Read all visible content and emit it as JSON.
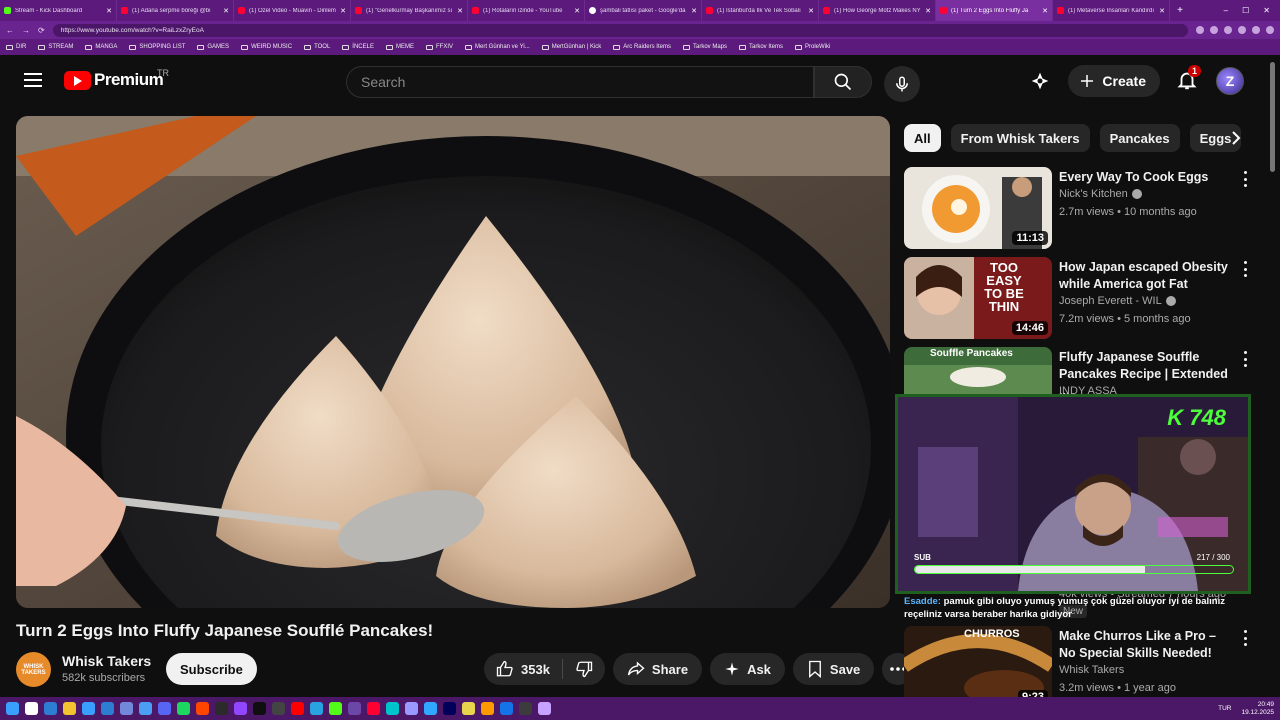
{
  "browser": {
    "tabs": [
      {
        "title": "Stream - Kick Dashboard",
        "fav": "kick"
      },
      {
        "title": "(1) Adana serpme böreği @bi",
        "fav": "yt"
      },
      {
        "title": "(1) Özel Video - Muavin - Dinlem",
        "fav": "yt"
      },
      {
        "title": "(1) \"Genelkurmay Başkanımız sı",
        "fav": "yt"
      },
      {
        "title": "(1) Rotaların izinde - YouTube",
        "fav": "yt"
      },
      {
        "title": "şambali tatlısı paket - Google'da",
        "fav": "g"
      },
      {
        "title": "(1) İstanbul'da İlk Ve Tek Sobalı",
        "fav": "yt"
      },
      {
        "title": "(1) How George Motz Makes NY",
        "fav": "yt"
      },
      {
        "title": "(1) Turn 2 Eggs Into Fluffy Ja",
        "fav": "yt",
        "active": true
      },
      {
        "title": "(1) Metaverse İnsanları Kandırdı",
        "fav": "yt"
      }
    ],
    "new_tab": "+",
    "window_controls": [
      "–",
      "☐",
      "✕"
    ],
    "url": "https://www.youtube.com/watch?v=RaiLzxZryEoA",
    "bookmarks": [
      "DIR",
      "STREAM",
      "MANGA",
      "SHOPPING LIST",
      "GAMES",
      "WEIRD MUSIC",
      "TOOL",
      "İNCELE",
      "MEME",
      "FFXIV",
      "Mert Günhan ve Yi...",
      "MertGünhan | Kick",
      "Arc Raiders Items",
      "Tarkov Maps",
      "Tarkov Items",
      "ProleWiki"
    ]
  },
  "header": {
    "logo_text": "Premium",
    "region": "TR",
    "search_placeholder": "Search",
    "create_label": "Create",
    "notification_count": "1",
    "avatar_letter": "Z"
  },
  "video": {
    "title": "Turn 2 Eggs Into Fluffy Japanese Soufflé Pancakes!",
    "channel": "Whisk Takers",
    "channel_avatar_text": "WHISK TAKERS",
    "subscribers": "582k subscribers",
    "subscribe_label": "Subscribe",
    "likes": "353k",
    "share_label": "Share",
    "ask_label": "Ask",
    "save_label": "Save"
  },
  "chips": [
    "All",
    "From Whisk Takers",
    "Pancakes",
    "Eggs"
  ],
  "recommendations": [
    {
      "title": "Every Way To Cook Eggs",
      "channel": "Nick's Kitchen",
      "verified": true,
      "meta": "2.7m views • 10 months ago",
      "duration": "11:13"
    },
    {
      "title": "How Japan escaped Obesity while America got Fat",
      "channel": "Joseph Everett - WIL",
      "verified": true,
      "meta": "7.2m views • 5 months ago",
      "duration": "14:46",
      "thumb_text": "TOO EASY TO BE THIN"
    },
    {
      "title": "Fluffy Japanese Souffle Pancakes Recipe | Extended ...",
      "channel": "INDY ASSA",
      "verified": false,
      "meta": "",
      "duration": "",
      "thumb_text": "Souffle Pancakes"
    },
    {
      "title": "Make Churros Like a Pro – No Special Skills Needed!",
      "channel": "Whisk Takers",
      "verified": false,
      "meta": "3.2m views • 1 year ago",
      "duration": "9:23",
      "thumb_text": "CHURROS"
    }
  ],
  "behind_overlay": {
    "meta": "40k views • Streamed 7 hours ago",
    "badge": "New"
  },
  "stream_overlay": {
    "counter": "K 748",
    "sub_label": "SUB",
    "progress_text": "217 / 300",
    "progress_fraction": 0.723
  },
  "chat": {
    "user": "Esadde:",
    "message": "pamuk gibi oluyo yumuş yumuş çok güzel oluyor iyi de balınız reçeliniz varsa beraber harika gidiyor"
  },
  "taskbar": {
    "lang": "TUR",
    "time": "20:49",
    "date": "19.12.2025"
  },
  "colors": {
    "yt_red": "#ff0000",
    "browser_purple": "#5b1a7c",
    "overlay_green": "#4cff3a"
  }
}
